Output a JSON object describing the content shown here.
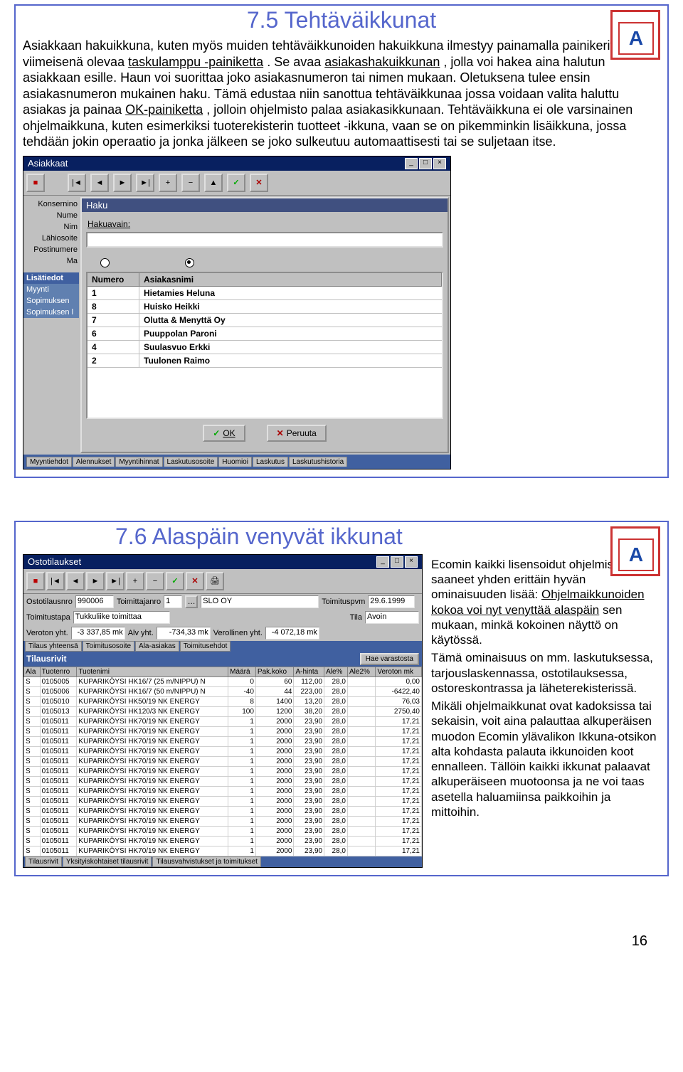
{
  "section1": {
    "title": "7.5 Tehtäväikkunat",
    "logo_letter": "A",
    "paragraph_parts": {
      "p1_a": "Asiakkaan hakuikkuna, kuten myös muiden tehtäväikkunoiden hakuikkuna ilmestyy painamalla painikerivin viimeisenä olevaa ",
      "p1_u1": "taskulamppu -painiketta",
      "p1_b": ". Se avaa ",
      "p1_u2": "asiakashakuikkunan",
      "p1_c": ", jolla voi hakea aina halutun asiakkaan esille. Haun voi suorittaa joko asiakasnumeron tai nimen mukaan. Oletuksena tulee ensin asiakasnumeron mukainen haku. Tämä edustaa niin sanottua tehtäväikkunaa jossa voidaan valita haluttu asiakas ja painaa ",
      "p1_u3": "OK-painiketta",
      "p1_d": ", jolloin ohjelmisto palaa asiakasikkunaan. Tehtäväikkuna ei ole varsinainen ohjelmaikkuna, kuten esimerkiksi tuoterekisterin tuotteet -ikkuna, vaan se on pikemminkin lisäikkuna, jossa tehdään jokin operaatio ja jonka jälkeen se joko sulkeutuu automaattisesti tai se suljetaan itse."
    },
    "asiakkaat": {
      "title": "Asiakkaat",
      "side": {
        "konserninro": "Konsernino",
        "numero": "Nume",
        "nimi": "Nim",
        "lahiosoite": "Lähiosoite",
        "postinumero": "Postinumere",
        "maa": "Ma",
        "lisatiedot": "Lisätiedot",
        "myynti": "Myynti",
        "sopimuksen": "Sopimuksen",
        "sopimuksen2": "Sopimuksen l"
      },
      "haku": {
        "title": "Haku",
        "avain": "Hakuavain:",
        "col_numero": "Numero",
        "col_nimi": "Asiakasnimi",
        "rows": [
          {
            "n": "1",
            "nimi": "Hietamies Heluna"
          },
          {
            "n": "8",
            "nimi": "Huisko Heikki"
          },
          {
            "n": "7",
            "nimi": "Olutta & Menyttä Oy"
          },
          {
            "n": "6",
            "nimi": "Puuppolan Paroni"
          },
          {
            "n": "4",
            "nimi": "Suulasvuo Erkki"
          },
          {
            "n": "2",
            "nimi": "Tuulonen Raimo"
          }
        ],
        "ok": "OK",
        "peruuta": "Peruuta"
      },
      "tabs": [
        "Myyntiehdot",
        "Alennukset",
        "Myyntihinnat",
        "Laskutusosoite",
        "Huomioi",
        "Laskutus",
        "Laskutushistoria"
      ]
    }
  },
  "section2": {
    "title": "7.6 Alaspäin venyvät ikkunat",
    "logo_letter": "A",
    "side": {
      "p1": "Ecomin kaikki lisensoidut ohjelmistot ovat saaneet yhden erittäin hyvän ominaisuuden lisää: ",
      "p1_u": "Ohjelmaikkunoiden kokoa voi nyt venyttää alaspäin",
      "p1_b": " sen mukaan, minkä kokoinen näyttö on käytössä.",
      "p2": "Tämä ominaisuus on mm. laskutuksessa, tarjouslaskennassa, ostotilauksessa, ostoreskontrassa ja läheterekisterissä.",
      "p3": "Mikäli ohjelmaikkunat ovat kadoksissa tai sekaisin, voit aina palauttaa alkuperäisen muodon Ecomin ylävalikon Ikkuna-otsikon alta kohdasta palauta ikkunoiden koot ennalleen. Tällöin kaikki ikkunat palaavat alkuperäiseen muotoonsa ja ne voi taas asetella haluamiinsa paikkoihin ja mittoihin."
    },
    "osto": {
      "title": "Ostotilaukset",
      "fields": {
        "ostotilausnro_l": "Ostotilausnro",
        "ostotilausnro": "990006",
        "toimittajanro_l": "Toimittajanro",
        "toimittajanro": "1",
        "toimittaja": "SLO OY",
        "toimituspvm_l": "Toimituspvm",
        "toimituspvm": "29.6.1999",
        "toimitustapa_l": "Toimitustapa",
        "toimitustapa": "Tukkuliike toimittaa",
        "tila_l": "Tila",
        "tila": "Avoin",
        "veroton_l": "Veroton yht.",
        "veroton": "-3 337,85 mk",
        "alv_l": "Alv yht.",
        "alv": "-734,33 mk",
        "verollinen_l": "Verollinen yht.",
        "verollinen": "-4 072,18 mk"
      },
      "midtabs": [
        "Tilaus yhteensä",
        "Toimitusosoite",
        "Ala-asiakas",
        "Toimitusehdot"
      ],
      "strip": "Tilausrivit",
      "hae": "Hae varastosta",
      "headers": [
        "Ala",
        "Tuotenro",
        "Tuotenimi",
        "Määrä",
        "Pak.koko",
        "A-hinta",
        "Ale%",
        "Ale2%",
        "Veroton mk"
      ],
      "rows": [
        [
          "S",
          "0105005",
          "KUPARIKÖYSI HK16/7 (25 m/NIPPU) N",
          "0",
          "60",
          "112,00",
          "28,0",
          "",
          "0,00"
        ],
        [
          "S",
          "0105006",
          "KUPARIKÖYSI HK16/7 (50 m/NIPPU) N",
          "-40",
          "44",
          "223,00",
          "28,0",
          "",
          "-6422,40"
        ],
        [
          "S",
          "0105010",
          "KUPARIKÖYSI HK50/19 NK ENERGY",
          "8",
          "1400",
          "13,20",
          "28,0",
          "",
          "76,03"
        ],
        [
          "S",
          "0105013",
          "KUPARIKÖYSI HK120/3 NK ENERGY",
          "100",
          "1200",
          "38,20",
          "28,0",
          "",
          "2750,40"
        ],
        [
          "S",
          "0105011",
          "KUPARIKÖYSI HK70/19 NK ENERGY",
          "1",
          "2000",
          "23,90",
          "28,0",
          "",
          "17,21"
        ],
        [
          "S",
          "0105011",
          "KUPARIKÖYSI HK70/19 NK ENERGY",
          "1",
          "2000",
          "23,90",
          "28,0",
          "",
          "17,21"
        ],
        [
          "S",
          "0105011",
          "KUPARIKÖYSI HK70/19 NK ENERGY",
          "1",
          "2000",
          "23,90",
          "28,0",
          "",
          "17,21"
        ],
        [
          "S",
          "0105011",
          "KUPARIKÖYSI HK70/19 NK ENERGY",
          "1",
          "2000",
          "23,90",
          "28,0",
          "",
          "17,21"
        ],
        [
          "S",
          "0105011",
          "KUPARIKÖYSI HK70/19 NK ENERGY",
          "1",
          "2000",
          "23,90",
          "28,0",
          "",
          "17,21"
        ],
        [
          "S",
          "0105011",
          "KUPARIKÖYSI HK70/19 NK ENERGY",
          "1",
          "2000",
          "23,90",
          "28,0",
          "",
          "17,21"
        ],
        [
          "S",
          "0105011",
          "KUPARIKÖYSI HK70/19 NK ENERGY",
          "1",
          "2000",
          "23,90",
          "28,0",
          "",
          "17,21"
        ],
        [
          "S",
          "0105011",
          "KUPARIKÖYSI HK70/19 NK ENERGY",
          "1",
          "2000",
          "23,90",
          "28,0",
          "",
          "17,21"
        ],
        [
          "S",
          "0105011",
          "KUPARIKÖYSI HK70/19 NK ENERGY",
          "1",
          "2000",
          "23,90",
          "28,0",
          "",
          "17,21"
        ],
        [
          "S",
          "0105011",
          "KUPARIKÖYSI HK70/19 NK ENERGY",
          "1",
          "2000",
          "23,90",
          "28,0",
          "",
          "17,21"
        ],
        [
          "S",
          "0105011",
          "KUPARIKÖYSI HK70/19 NK ENERGY",
          "1",
          "2000",
          "23,90",
          "28,0",
          "",
          "17,21"
        ],
        [
          "S",
          "0105011",
          "KUPARIKÖYSI HK70/19 NK ENERGY",
          "1",
          "2000",
          "23,90",
          "28,0",
          "",
          "17,21"
        ],
        [
          "S",
          "0105011",
          "KUPARIKÖYSI HK70/19 NK ENERGY",
          "1",
          "2000",
          "23,90",
          "28,0",
          "",
          "17,21"
        ],
        [
          "S",
          "0105011",
          "KUPARIKÖYSI HK70/19 NK ENERGY",
          "1",
          "2000",
          "23,90",
          "28,0",
          "",
          "17,21"
        ]
      ],
      "tabs": [
        "Tilausrivit",
        "Yksityiskohtaiset tilausrivit",
        "Tilausvahvistukset ja toimitukset"
      ]
    }
  },
  "page_number": "16"
}
